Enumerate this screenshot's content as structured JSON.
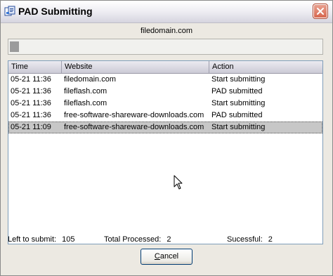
{
  "window": {
    "title": "PAD Submitting",
    "title_icon": "pad-app-icon",
    "close_icon": "close-icon",
    "accent_close": "#d7674f"
  },
  "status": {
    "current_domain": "filedomain.com",
    "progress_fraction": 0.03
  },
  "table": {
    "columns": [
      "Time",
      "Website",
      "Action"
    ],
    "rows": [
      {
        "time": "05-21 11:36",
        "website": "filedomain.com",
        "action": "Start submitting"
      },
      {
        "time": "05-21 11:36",
        "website": "fileflash.com",
        "action": "PAD submitted"
      },
      {
        "time": "05-21 11:36",
        "website": "fileflash.com",
        "action": "Start submitting"
      },
      {
        "time": "05-21 11:36",
        "website": "free-software-shareware-downloads.com",
        "action": "PAD submitted"
      },
      {
        "time": "05-21 11:09",
        "website": "free-software-shareware-downloads.com",
        "action": "Start submitting",
        "selected": true
      }
    ]
  },
  "stats": {
    "left_label": "Left to submit:",
    "left_value": "105",
    "total_label": "Total Processed:",
    "total_value": "2",
    "success_label": "Sucessful:",
    "success_value": "2"
  },
  "buttons": {
    "cancel_label": "Cancel",
    "cancel_accel": "C",
    "cancel_rest": "ancel"
  }
}
